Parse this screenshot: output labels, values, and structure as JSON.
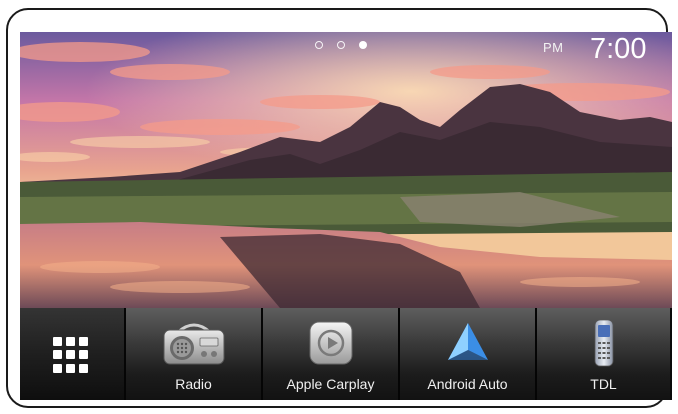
{
  "status_bar": {
    "page_dots": [
      false,
      false,
      true
    ],
    "ampm": "PM",
    "time": "7:00"
  },
  "dock": {
    "menu_icon": "apps-grid-icon",
    "apps": [
      {
        "label": "Radio",
        "icon": "radio-icon"
      },
      {
        "label": "Apple Carplay",
        "icon": "apple-carplay-icon"
      },
      {
        "label": "Android Auto",
        "icon": "android-auto-icon"
      },
      {
        "label": "TDL",
        "icon": "phone-icon"
      }
    ]
  },
  "colors": {
    "bezel": "#1a1a1a",
    "android_auto_blue": "#3b8ee6",
    "android_auto_light": "#8fd0ff"
  }
}
